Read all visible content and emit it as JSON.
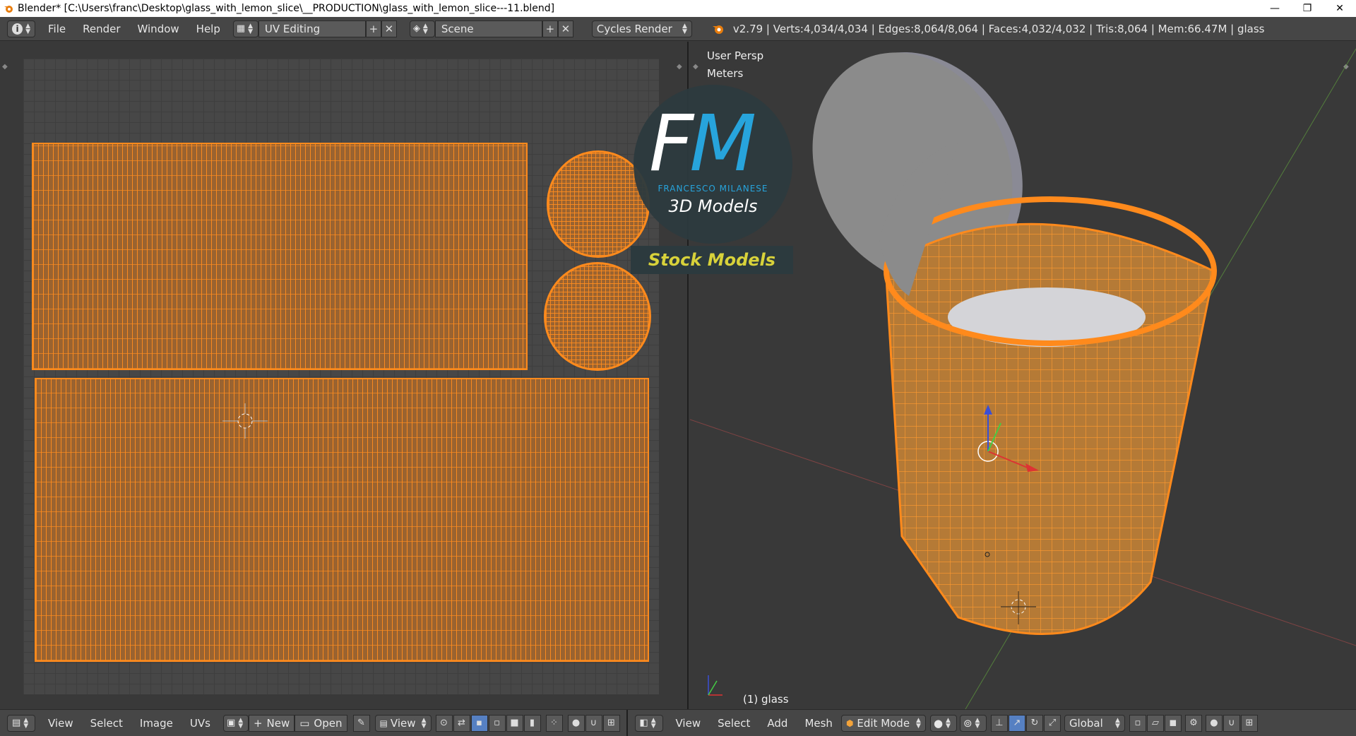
{
  "window": {
    "title": "Blender* [C:\\Users\\franc\\Desktop\\glass_with_lemon_slice\\__PRODUCTION\\glass_with_lemon_slice---11.blend]",
    "minimize": "—",
    "restore": "❐",
    "close": "✕"
  },
  "info_header": {
    "menus": [
      "File",
      "Render",
      "Window",
      "Help"
    ],
    "screen_layout": "UV Editing",
    "scene": "Scene",
    "render_engine": "Cycles Render",
    "stats": "v2.79 | Verts:4,034/4,034 | Edges:8,064/8,064 | Faces:4,032/4,032 | Tris:8,064 | Mem:66.47M | glass"
  },
  "uv_editor": {
    "menus": [
      "View",
      "Select",
      "Image",
      "UVs"
    ],
    "new_label": "New",
    "open_label": "Open",
    "view_dropdown": "View"
  },
  "viewport": {
    "view_name": "User Persp",
    "units": "Meters",
    "object_label": "(1) glass",
    "menus": [
      "View",
      "Select",
      "Add",
      "Mesh"
    ],
    "mode": "Edit Mode",
    "orientation": "Global"
  },
  "watermark": {
    "fm_f": "F",
    "fm_m": "M",
    "brand_name": "FRANCESCO MILANESE",
    "tagline": "3D Models",
    "stock": "Stock Models"
  },
  "colors": {
    "mesh_selected": "#ff8a1c",
    "header_bg": "#464646",
    "editor_bg": "#393939",
    "brand_blue": "#27a4dc",
    "brand_yellow": "#d8d23a"
  }
}
